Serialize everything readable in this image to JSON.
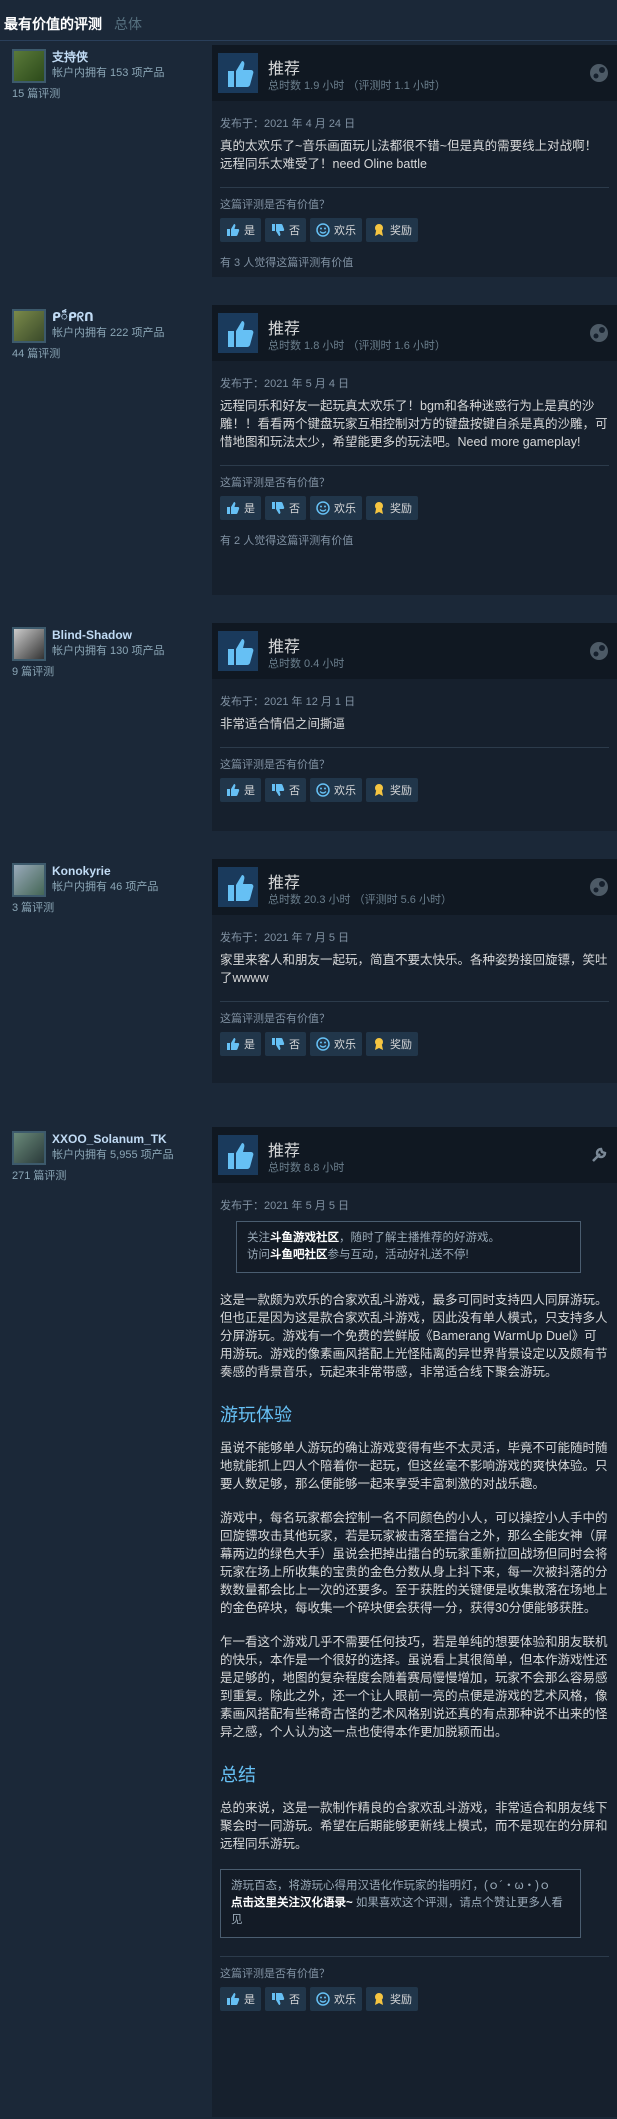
{
  "tabs": {
    "active": "最有价值的评测",
    "inactive": "总体"
  },
  "common": {
    "recommend": "推荐",
    "helpful_q": "这篇评测是否有价值？",
    "vote_yes": "是",
    "vote_no": "否",
    "vote_funny": "欢乐",
    "vote_award": "奖励"
  },
  "reviews": [
    {
      "username": "支持侠",
      "products": "帐户内拥有 153 项产品",
      "count": "15 篇评测",
      "hours": "总时数 1.9 小时 （评测时 1.1 小时）",
      "date": "发布于：2021 年 4 月 24 日",
      "text": "真的太欢乐了~音乐画面玩儿法都很不错~但是真的需要线上对战啊！远程同乐太难受了！need Oline battle",
      "votes": "有 3 人觉得这篇评测有价值"
    },
    {
      "username": "ᑭ៏ᑭᖇᑎ",
      "products": "帐户内拥有 222 项产品",
      "count": "44 篇评测",
      "hours": "总时数 1.8 小时 （评测时 1.6 小时）",
      "date": "发布于：2021 年 5 月 4 日",
      "text": "远程同乐和好友一起玩真太欢乐了！bgm和各种迷惑行为上是真的沙雕！！看看两个键盘玩家互相控制对方的键盘按键自杀是真的沙雕，可惜地图和玩法太少，希望能更多的玩法吧。Need more gameplay!",
      "votes": "有 2 人觉得这篇评测有价值"
    },
    {
      "username": "Blind-Shadow",
      "products": "帐户内拥有 130 项产品",
      "count": "9 篇评测",
      "hours": "总时数 0.4 小时",
      "date": "发布于：2021 年 12 月 1 日",
      "text": "非常适合情侣之间撕逼"
    },
    {
      "username": "Konokyrie",
      "products": "帐户内拥有 46 项产品",
      "count": "3 篇评测",
      "hours": "总时数 20.3 小时 （评测时 5.6 小时）",
      "date": "发布于：2021 年 7 月 5 日",
      "text": "家里来客人和朋友一起玩，简直不要太快乐。各种姿势接回旋镖，笑吐了wwww"
    },
    {
      "username": "XXOO_Solanum_TK",
      "products": "帐户内拥有 5,955 项产品",
      "count": "271 篇评测",
      "hours": "总时数 8.8 小时",
      "date": "发布于：2021 年 5 月 5 日",
      "quote1_a": "关注",
      "quote1_b": "斗鱼游戏社区",
      "quote1_c": "，随时了解主播推荐的好游戏。",
      "quote1_d": "访问",
      "quote1_e": "斗鱼吧社区",
      "quote1_f": "参与互动，活动好礼送不停!",
      "p1": "这是一款颇为欢乐的合家欢乱斗游戏，最多可同时支持四人同屏游玩。但也正是因为这是款合家欢乱斗游戏，因此没有单人模式，只支持多人分屏游玩。游戏有一个免费的尝鲜版《Bamerang WarmUp Duel》可用游玩。游戏的像素画风搭配上光怪陆离的异世界背景设定以及颇有节奏感的背景音乐，玩起来非常带感，非常适合线下聚会游玩。",
      "h1": "游玩体验",
      "p2": "虽说不能够单人游玩的确让游戏变得有些不太灵活，毕竟不可能随时随地就能抓上四人个陪着你一起玩，但这丝毫不影响游戏的爽快体验。只要人数足够，那么便能够一起来享受丰富刺激的对战乐趣。",
      "p3": "游戏中，每名玩家都会控制一名不同颜色的小人，可以操控小人手中的回旋镖攻击其他玩家，若是玩家被击落至擂台之外，那么全能女神（屏幕两边的绿色大手）虽说会把掉出擂台的玩家重新拉回战场但同时会将玩家在场上所收集的宝贵的金色分数从身上抖下来，每一次被抖落的分数数量都会比上一次的还要多。至于获胜的关键便是收集散落在场地上的金色碎块，每收集一个碎块便会获得一分，获得30分便能够获胜。",
      "p4": "乍一看这个游戏几乎不需要任何技巧，若是单纯的想要体验和朋友联机的快乐，本作是一个很好的选择。虽说看上其很简单，但本作游戏性还是足够的，地图的复杂程度会随着赛局慢慢增加，玩家不会那么容易感到重复。除此之外，还一个让人眼前一亮的点便是游戏的艺术风格，像素画风搭配有些稀奇古怪的艺术风格别说还真的有点那种说不出来的怪异之感，个人认为这一点也使得本作更加脱颖而出。",
      "h2": "总结",
      "p5": "总的来说，这是一款制作精良的合家欢乱斗游戏，非常适合和朋友线下聚会时一同游玩。希望在后期能够更新线上模式，而不是现在的分屏和远程同乐游玩。",
      "quote2_a": "游玩百态，将游玩心得用汉语化作玩家的指明灯，(ｏ´・ω・)ｏ",
      "quote2_b": "点击这里关注汉化语录~",
      "quote2_c": " 如果喜欢这个评测，请点个赞让更多人看见"
    }
  ],
  "colors": {
    "bg": "#1b2838",
    "panel": "#16202d",
    "accent": "#67c1f5",
    "thumb": "#1a3a5c"
  }
}
